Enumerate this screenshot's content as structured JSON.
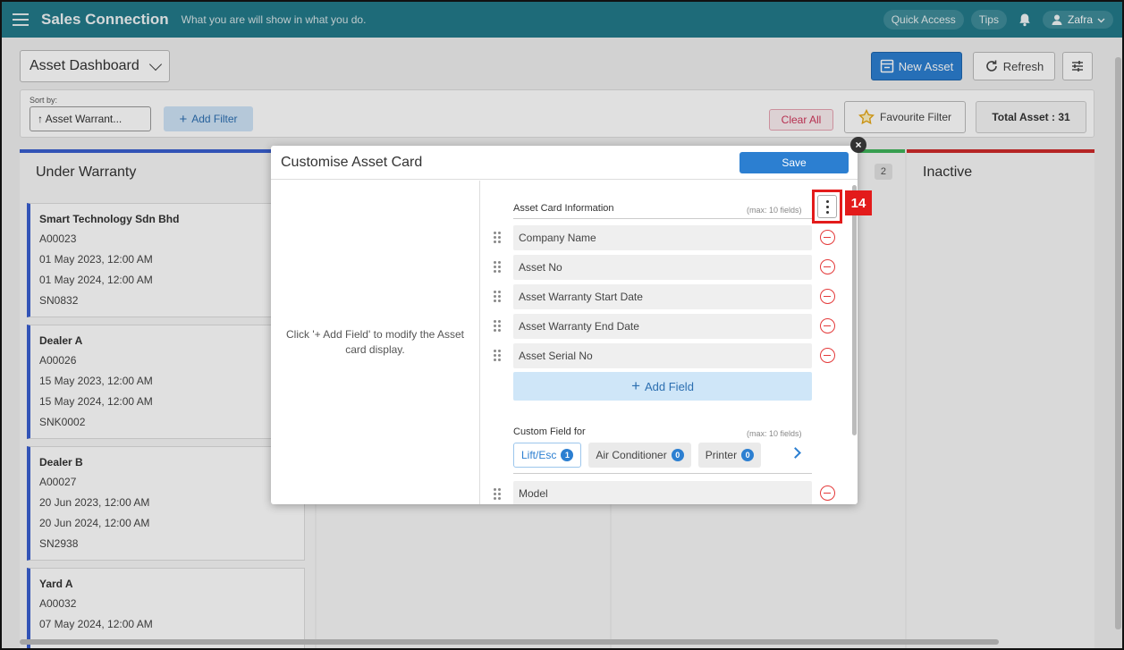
{
  "topbar": {
    "app_title": "Sales Connection",
    "tagline": "What you are will show in what you do.",
    "quick_access": "Quick Access",
    "tips": "Tips",
    "user_name": "Zafra"
  },
  "toolbar": {
    "dashboard_select": "Asset Dashboard",
    "new_asset": "New Asset",
    "refresh": "Refresh"
  },
  "filterbar": {
    "sort_by_label": "Sort by:",
    "sort_value": "↑ Asset Warrant...",
    "add_filter": "Add Filter",
    "clear_all": "Clear All",
    "favourite_filter": "Favourite Filter",
    "total_asset": "Total Asset : 31"
  },
  "columns": [
    {
      "title": "Under Warranty",
      "count": ""
    },
    {
      "title": "",
      "count": ""
    },
    {
      "title": "",
      "count": "2"
    },
    {
      "title": "Inactive",
      "count": ""
    }
  ],
  "cards": [
    {
      "title": "Smart Technology Sdn Bhd",
      "asset_no": "A00023",
      "start": "01 May 2023, 12:00 AM",
      "end": "01 May 2024, 12:00 AM",
      "serial": "SN0832"
    },
    {
      "title": "Dealer A",
      "asset_no": "A00026",
      "start": "15 May 2023, 12:00 AM",
      "end": "15 May 2024, 12:00 AM",
      "serial": "SNK0002"
    },
    {
      "title": "Dealer B",
      "asset_no": "A00027",
      "start": "20 Jun 2023, 12:00 AM",
      "end": "20 Jun 2024, 12:00 AM",
      "serial": "SN2938"
    },
    {
      "title": "Yard A",
      "asset_no": "A00032",
      "start": "07 May 2024, 12:00 AM",
      "end": "",
      "serial": ""
    }
  ],
  "modal": {
    "title": "Customise Asset Card",
    "save": "Save",
    "left_hint": "Click '+ Add Field' to modify the Asset card display.",
    "asset_info_label": "Asset Card Information",
    "asset_info_max": "(max: 10 fields)",
    "fields": [
      "Company Name",
      "Asset No",
      "Asset Warranty Start Date",
      "Asset Warranty End Date",
      "Asset Serial No"
    ],
    "add_field": "Add Field",
    "custom_label": "Custom Field for",
    "custom_max": "(max: 10 fields)",
    "tabs": [
      {
        "label": "Lift/Esc",
        "count": "1"
      },
      {
        "label": "Air Conditioner",
        "count": "0"
      },
      {
        "label": "Printer",
        "count": "0"
      }
    ],
    "custom_fields": [
      "Model"
    ]
  },
  "annotation": {
    "step": "14"
  },
  "colors": {
    "topbar": "#237a8a",
    "primary": "#2c7fd1",
    "danger": "#e43a3a",
    "highlight": "#e31b1b"
  }
}
